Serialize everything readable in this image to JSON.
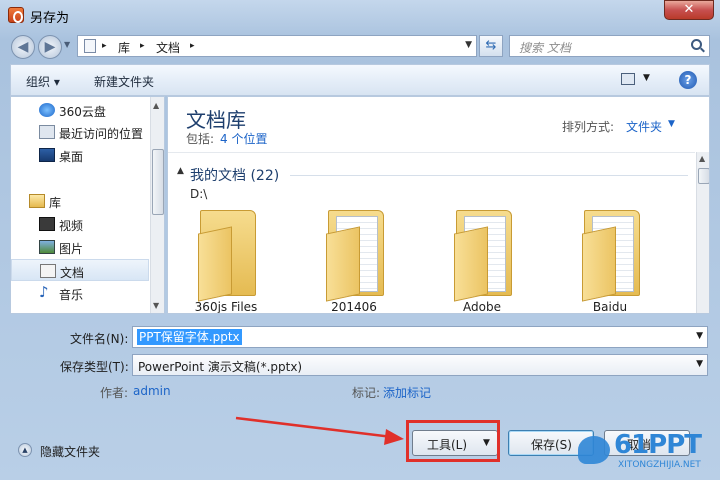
{
  "window": {
    "title": "另存为",
    "close_label": "✕"
  },
  "address": {
    "segments": [
      "库",
      "文档"
    ],
    "separator": "▸"
  },
  "search": {
    "placeholder": "搜索 文档"
  },
  "toolbar": {
    "organize": "组织 ▾",
    "new_folder": "新建文件夹"
  },
  "sidebar": {
    "items": [
      {
        "label": "360云盘",
        "icon": "cloud-icon"
      },
      {
        "label": "最近访问的位置",
        "icon": "recent-places-icon"
      },
      {
        "label": "桌面",
        "icon": "desktop-icon"
      },
      {
        "label": "库",
        "icon": "library-icon"
      },
      {
        "label": "视频",
        "icon": "video-icon"
      },
      {
        "label": "图片",
        "icon": "picture-icon"
      },
      {
        "label": "文档",
        "icon": "document-icon",
        "selected": true
      },
      {
        "label": "音乐",
        "icon": "music-icon"
      }
    ]
  },
  "library": {
    "title": "文档库",
    "includes_label": "包括:",
    "includes_link": "4 个位置",
    "arrange_label": "排列方式:",
    "arrange_value": "文件夹"
  },
  "group": {
    "title": "我的文档 (22)",
    "path": "D:\\"
  },
  "folders": [
    {
      "name": "360js Files"
    },
    {
      "name": "201406"
    },
    {
      "name": "Adobe"
    },
    {
      "name": "Baidu"
    }
  ],
  "form": {
    "filename_label": "文件名(N):",
    "filename_value": "PPT保留字体.pptx",
    "filetype_label": "保存类型(T):",
    "filetype_value": "PowerPoint 演示文稿(*.pptx)",
    "author_label": "作者:",
    "author_value": "admin",
    "tags_label": "标记:",
    "tags_value": "添加标记"
  },
  "footer": {
    "hide_folders": "隐藏文件夹",
    "tools": "工具(L)",
    "save": "保存(S)",
    "cancel": "取消"
  },
  "watermark": {
    "big": "61PPT",
    "small": "XITONGZHIJIA.NET"
  }
}
